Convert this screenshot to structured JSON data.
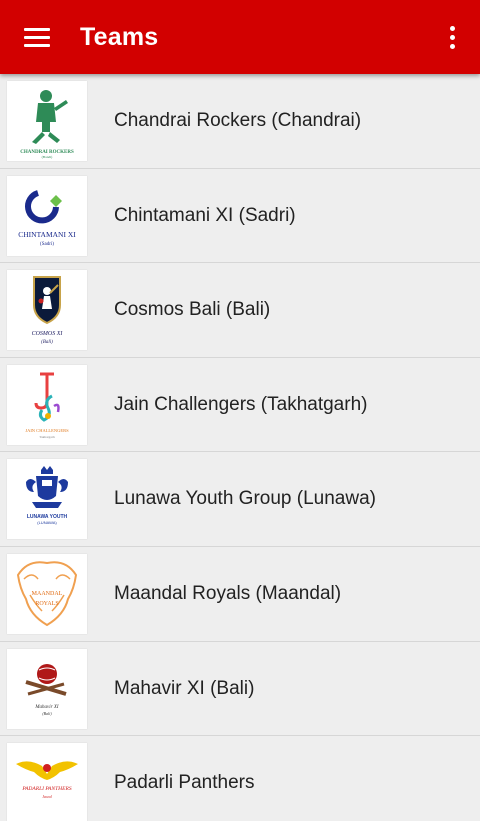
{
  "app": {
    "title": "Teams"
  },
  "colors": {
    "appbar": "#d20000",
    "background": "#eeeeee",
    "text": "#222222"
  },
  "icons": {
    "menu": "hamburger-icon",
    "overflow": "more-vert-icon"
  },
  "teams": [
    {
      "name": "Chandrai Rockers (Chandrai)",
      "logo_icon": "chandrai-rockers-logo",
      "logo_text": "CHANDRAI ROCKERS",
      "logo_subtext": "(Bandi)"
    },
    {
      "name": "Chintamani XI (Sadri)",
      "logo_icon": "chintamani-xi-logo",
      "logo_text": "CHINTAMANI XI",
      "logo_subtext": "(Sadri)"
    },
    {
      "name": "Cosmos Bali (Bali)",
      "logo_icon": "cosmos-bali-logo",
      "logo_text": "COSMOS XI",
      "logo_subtext": "(Bali)"
    },
    {
      "name": "Jain Challengers (Takhatgarh)",
      "logo_icon": "jain-challengers-logo",
      "logo_text": "JAIN CHALLENGERS",
      "logo_subtext": "Takhatgarh"
    },
    {
      "name": "Lunawa Youth Group (Lunawa)",
      "logo_icon": "lunawa-youth-group-logo",
      "logo_text": "LUNAWA YOUTH",
      "logo_subtext": "(LUNAWA)"
    },
    {
      "name": "Maandal Royals (Maandal)",
      "logo_icon": "maandal-royals-logo",
      "logo_text": "MAANDAL",
      "logo_subtext": "ROYALS"
    },
    {
      "name": "Mahavir XI (Bali)",
      "logo_icon": "mahavir-xi-logo",
      "logo_text": "Mahavir XI",
      "logo_subtext": "(Bali)"
    },
    {
      "name": "Padarli Panthers",
      "logo_icon": "padarli-panthers-logo",
      "logo_text": "PADARLI PANTHERS",
      "logo_subtext": "Jawal"
    }
  ]
}
